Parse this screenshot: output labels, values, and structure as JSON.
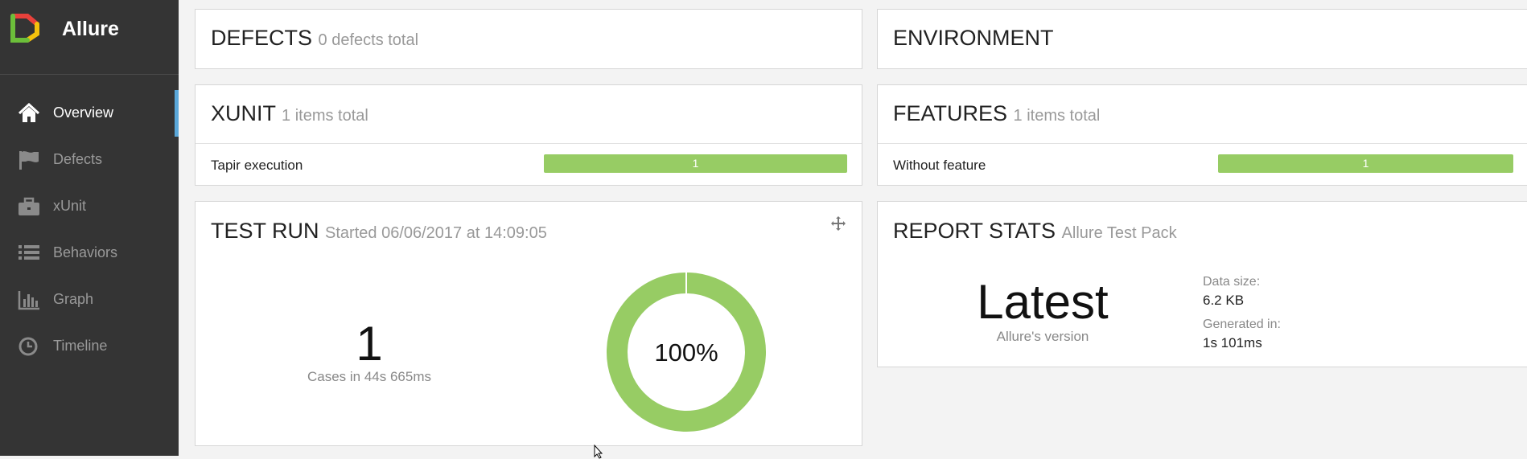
{
  "sidebar": {
    "brand": "Allure",
    "items": [
      {
        "label": "Overview",
        "icon": "home-icon",
        "active": true
      },
      {
        "label": "Defects",
        "icon": "flag-icon"
      },
      {
        "label": "xUnit",
        "icon": "briefcase-icon"
      },
      {
        "label": "Behaviors",
        "icon": "list-icon"
      },
      {
        "label": "Graph",
        "icon": "bar-chart-icon"
      },
      {
        "label": "Timeline",
        "icon": "clock-icon"
      }
    ]
  },
  "defects": {
    "title": "DEFECTS",
    "subtitle": "0 defects total"
  },
  "environment": {
    "title": "ENVIRONMENT"
  },
  "xunit": {
    "title": "XUNIT",
    "subtitle": "1 items total",
    "rows": [
      {
        "label": "Tapir execution",
        "count": "1",
        "passed_fraction": 1.0
      }
    ]
  },
  "features": {
    "title": "FEATURES",
    "subtitle": "1 items total",
    "rows": [
      {
        "label": "Without feature",
        "count": "1",
        "passed_fraction": 1.0
      }
    ]
  },
  "test_run": {
    "title": "TEST RUN",
    "subtitle": "Started 06/06/2017 at 14:09:05",
    "cases": "1",
    "caption": "Cases in 44s 665ms",
    "percent_label": "100%",
    "passed_fraction": 1.0
  },
  "report_stats": {
    "title": "REPORT STATS",
    "subtitle": "Allure Test Pack",
    "version": "Latest",
    "version_caption": "Allure's version",
    "data_size_label": "Data size:",
    "data_size": "6.2 KB",
    "generated_label": "Generated in:",
    "generated": "1s 101ms"
  },
  "colors": {
    "sidebar_bg": "#343434",
    "accent": "#5aa7d9",
    "passed": "#97cc64"
  }
}
